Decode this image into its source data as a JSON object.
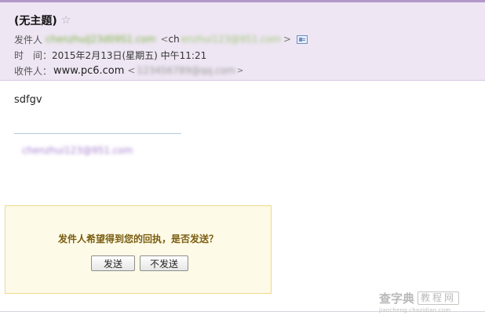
{
  "email": {
    "subject": "(无主题)",
    "star_icon": "☆",
    "sender_label": "发件人",
    "sender_name": "chenzhuiJ23d09S1.com",
    "sender_email_prefix": "ch",
    "sender_email_rest": "enzhui123@951.com",
    "sender_bracket_close": ">",
    "time_label": "时　间：",
    "time_value": "2015年2月13日(星期五) 中午11:21",
    "recipient_label": "收件人：",
    "recipient_value": "www.pc6.com",
    "recipient_open_bracket": "<",
    "recipient_email": "123456789@qq.com",
    "recipient_close_bracket": ">",
    "body_text": "sdfgv",
    "signature_email": "chenzhui123@951.com"
  },
  "receipt": {
    "question": "发件人希望得到您的回执，是否发送？",
    "send_label": "发送",
    "nosend_label": "不发送"
  },
  "watermark": {
    "main": "查字典",
    "boxed": "教程网",
    "sub": "jiaocheng.chazidian.com"
  },
  "colors": {
    "header_bg": "#eee6f3",
    "header_border": "#b296c8",
    "receipt_bg": "#fdfae7",
    "receipt_border": "#eed98a",
    "receipt_text": "#7a5d10"
  }
}
